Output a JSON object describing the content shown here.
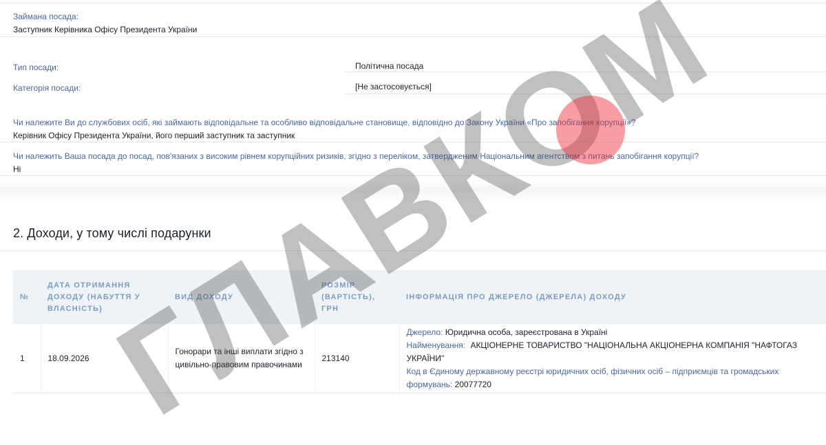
{
  "position": {
    "held_label": "Займана посада:",
    "held_value": "Заступник Керівника Офісу Президента України",
    "type_label": "Тип посади:",
    "type_value": "Політична посада",
    "category_label": "Категорія посади:",
    "category_value": "[Не застосовується]",
    "q1_label": "Чи належите Ви до службових осіб, які займають відповідальне та особливо відповідальне становище, відповідно до Закону України «Про запобігання корупції»?",
    "q1_value": "Керівник Офісу Президента України, його перший заступник та заступник",
    "q2_label": "Чи належить Ваша посада до посад, пов'язаних з високим рівнем корупційних ризиків, згідно з переліком, затвердженим Національним агентством з питань запобігання корупції?",
    "q2_value": "Ні"
  },
  "section": {
    "title": "2. Доходи, у тому числі подарунки"
  },
  "income_table": {
    "headers": [
      "№",
      "ДАТА ОТРИМАННЯ ДОХОДУ (НАБУТТЯ У ВЛАСНІСТЬ)",
      "ВИД ДОХОДУ",
      "РОЗМІР (ВАРТІСТЬ), ГРН",
      "ІНФОРМАЦІЯ ПРО ДЖЕРЕЛО (ДЖЕРЕЛА) ДОХОДУ"
    ],
    "rows": [
      {
        "num": "1",
        "date": "18.09.2026",
        "type": "Гонорари та інші виплати згідно з цивільно-правовим правочинами",
        "amount": "213140",
        "source_label": "Джерело:",
        "source_value": "Юридична особа, зареєстрована в Україні",
        "name_label": "Найменування:",
        "name_value": "АКЦІОНЕРНЕ ТОВАРИСТВО \"НАЦІОНАЛЬНА АКЦІОНЕРНА КОМПАНІЯ \"НАФТОГАЗ УКРАЇНИ\"",
        "code_label": "Код в Єдиному державному реєстрі юридичних осіб, фізичних осіб – підприємців та громадських формувань:",
        "code_value": "20077720"
      }
    ]
  },
  "watermark": {
    "text": "ГЛАВКОМ",
    "dot_color": "#ec2832"
  }
}
